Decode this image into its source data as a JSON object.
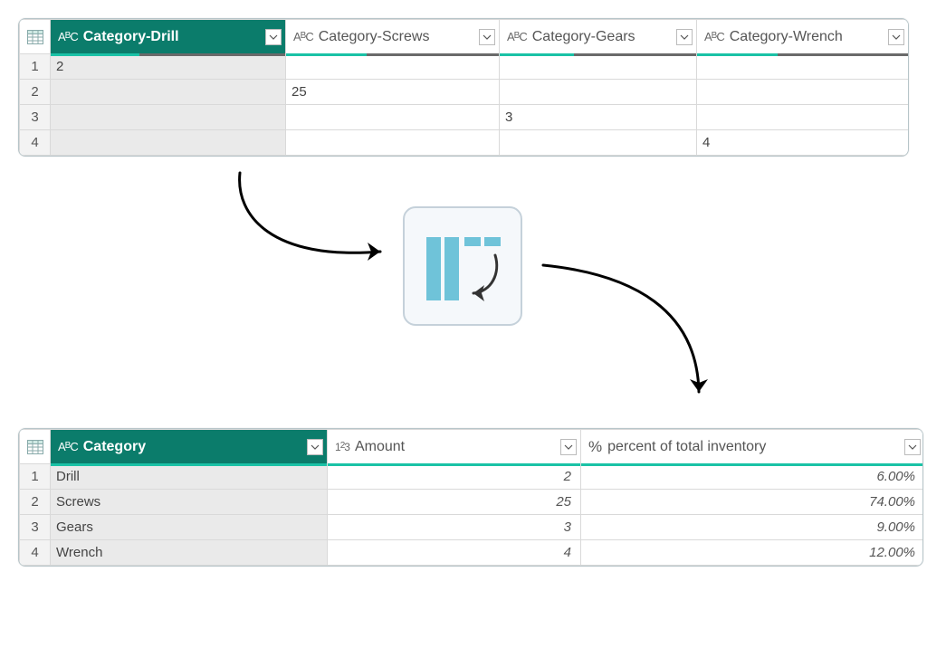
{
  "table_top": {
    "columns": [
      {
        "type": "abc",
        "label": "Category-Drill",
        "selected": true
      },
      {
        "type": "abc",
        "label": "Category-Screws",
        "selected": false
      },
      {
        "type": "abc",
        "label": "Category-Gears",
        "selected": false
      },
      {
        "type": "abc",
        "label": "Category-Wrench",
        "selected": false
      }
    ],
    "rows": [
      {
        "n": "1",
        "cells": [
          "2",
          "",
          "",
          ""
        ]
      },
      {
        "n": "2",
        "cells": [
          "",
          "25",
          "",
          ""
        ]
      },
      {
        "n": "3",
        "cells": [
          "",
          "",
          "3",
          ""
        ]
      },
      {
        "n": "4",
        "cells": [
          "",
          "",
          "",
          "4"
        ]
      }
    ]
  },
  "table_bot": {
    "columns": [
      {
        "type": "abc",
        "label": "Category",
        "selected": true
      },
      {
        "type": "123",
        "label": "Amount",
        "selected": false
      },
      {
        "type": "pct",
        "label": "percent of total inventory",
        "selected": false
      }
    ],
    "rows": [
      {
        "n": "1",
        "cat": "Drill",
        "amt": "2",
        "pct": "6.00%"
      },
      {
        "n": "2",
        "cat": "Screws",
        "amt": "25",
        "pct": "74.00%"
      },
      {
        "n": "3",
        "cat": "Gears",
        "amt": "3",
        "pct": "9.00%"
      },
      {
        "n": "4",
        "cat": "Wrench",
        "amt": "4",
        "pct": "12.00%"
      }
    ]
  },
  "icons": {
    "unpivot": "unpivot-columns-icon"
  }
}
